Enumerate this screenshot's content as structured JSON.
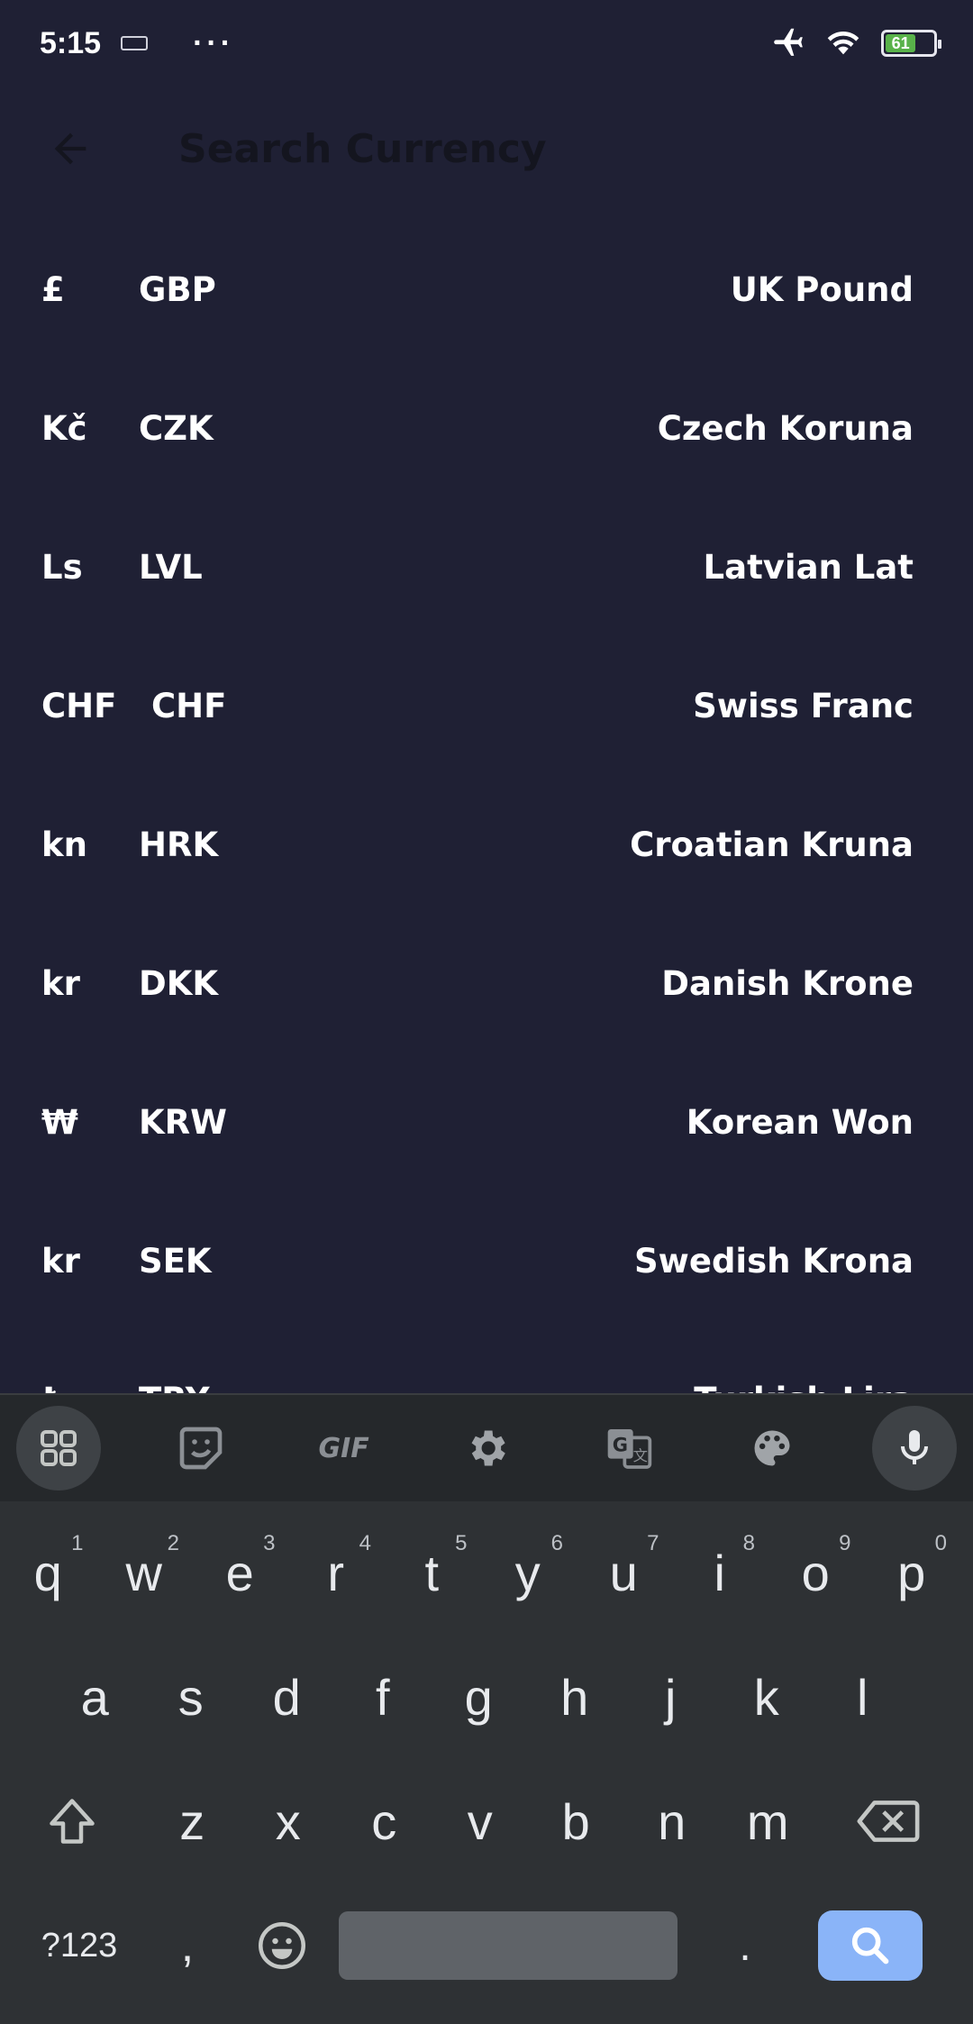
{
  "status_bar": {
    "time": "5:15",
    "more": "···",
    "battery_level": "61"
  },
  "app_bar": {
    "search_placeholder": "Search Currency"
  },
  "currencies": [
    {
      "symbol": "£",
      "code": "GBP",
      "name": "UK Pound"
    },
    {
      "symbol": "Kč",
      "code": "CZK",
      "name": "Czech Koruna"
    },
    {
      "symbol": "Ls",
      "code": "LVL",
      "name": "Latvian Lat"
    },
    {
      "symbol": "CHF",
      "code": "CHF",
      "name": "Swiss Franc"
    },
    {
      "symbol": "kn",
      "code": "HRK",
      "name": "Croatian Kruna"
    },
    {
      "symbol": "kr",
      "code": "DKK",
      "name": "Danish Krone"
    },
    {
      "symbol": "₩",
      "code": "KRW",
      "name": "Korean Won"
    },
    {
      "symbol": "kr",
      "code": "SEK",
      "name": "Swedish Krona"
    },
    {
      "symbol": "₺",
      "code": "TRY",
      "name": "Turkish Lira"
    }
  ],
  "keyboard": {
    "gif_label": "GIF",
    "row1": [
      {
        "key": "q",
        "hint": "1"
      },
      {
        "key": "w",
        "hint": "2"
      },
      {
        "key": "e",
        "hint": "3"
      },
      {
        "key": "r",
        "hint": "4"
      },
      {
        "key": "t",
        "hint": "5"
      },
      {
        "key": "y",
        "hint": "6"
      },
      {
        "key": "u",
        "hint": "7"
      },
      {
        "key": "i",
        "hint": "8"
      },
      {
        "key": "o",
        "hint": "9"
      },
      {
        "key": "p",
        "hint": "0"
      }
    ],
    "row2": [
      "a",
      "s",
      "d",
      "f",
      "g",
      "h",
      "j",
      "k",
      "l"
    ],
    "row3": [
      "z",
      "x",
      "c",
      "v",
      "b",
      "n",
      "m"
    ],
    "symbols_label": "?123",
    "comma_label": ",",
    "period_label": "."
  }
}
